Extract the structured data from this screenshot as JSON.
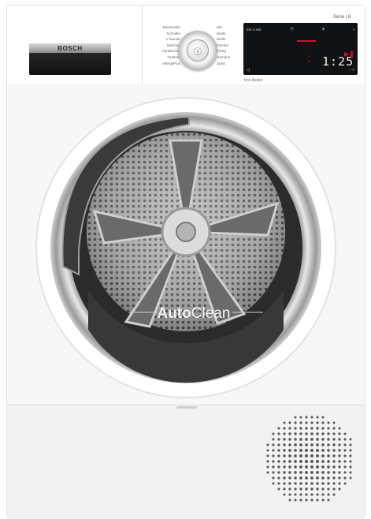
{
  "brand": {
    "name": "BOSCH"
  },
  "series_label": "Serie | 8",
  "programs_left": [
    "Baumwolle",
    "Schnelle",
    "1 Stunde",
    "Mischen",
    "Handtücher",
    "Outdoor",
    "AllergyPlus"
  ],
  "programs_right": [
    "Mix",
    "Seide",
    "Wolle",
    "Feinste",
    "Fertig",
    "Hemden",
    "Sport"
  ],
  "knob": {
    "icon": "power-icon",
    "glyph": "ⓘ"
  },
  "display": {
    "top_left": "Ein 3 sek.",
    "top_icons": [
      "Ⓞ",
      "⊕",
      "ᵍ"
    ],
    "time": "1:25",
    "bottom_left": "◁",
    "bottom_right": "◔ +"
  },
  "iron_assist": "Iron Assist",
  "door": {
    "label_bold": "Auto",
    "label_regular": "Clean"
  },
  "colors": {
    "accent": "#d5112d",
    "display_bg": "#101214",
    "chrome": "#b9b9b9"
  }
}
